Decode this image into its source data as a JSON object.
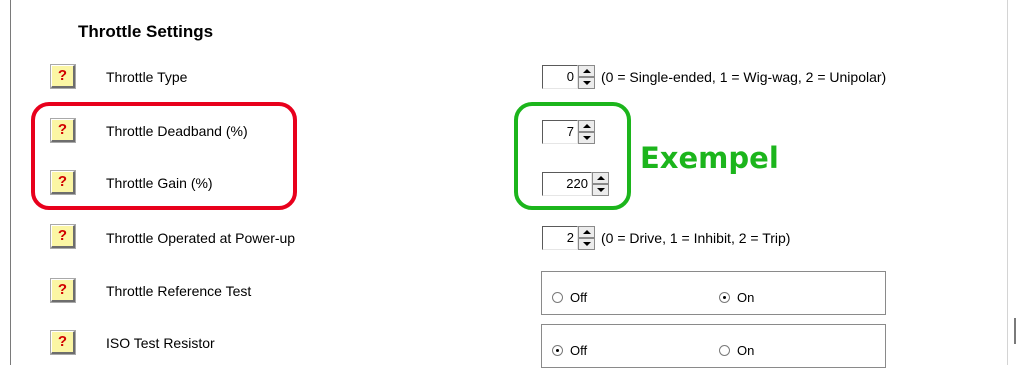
{
  "section": {
    "title": "Throttle Settings"
  },
  "help_label": "?",
  "rows": [
    {
      "label": "Throttle Type",
      "value": "0",
      "hint": "(0 = Single-ended, 1 = Wig-wag, 2 = Unipolar)"
    },
    {
      "label": "Throttle Deadband (%)",
      "value": "7",
      "hint": ""
    },
    {
      "label": "Throttle Gain (%)",
      "value": "220",
      "hint": ""
    },
    {
      "label": "Throttle Operated at Power-up",
      "value": "2",
      "hint": "(0 = Drive, 1 = Inhibit, 2 = Trip)"
    },
    {
      "label": "Throttle Reference Test",
      "options": [
        "Off",
        "On"
      ],
      "selected": "On"
    },
    {
      "label": "ISO Test Resistor",
      "options": [
        "Off",
        "On"
      ],
      "selected": "Off"
    }
  ],
  "annotation": {
    "text": "Exempel"
  },
  "colors": {
    "help_bg": "#fbf6a4",
    "help_mark": "#d20000",
    "red_highlight": "#e8001c",
    "green_highlight": "#1cb51c"
  }
}
